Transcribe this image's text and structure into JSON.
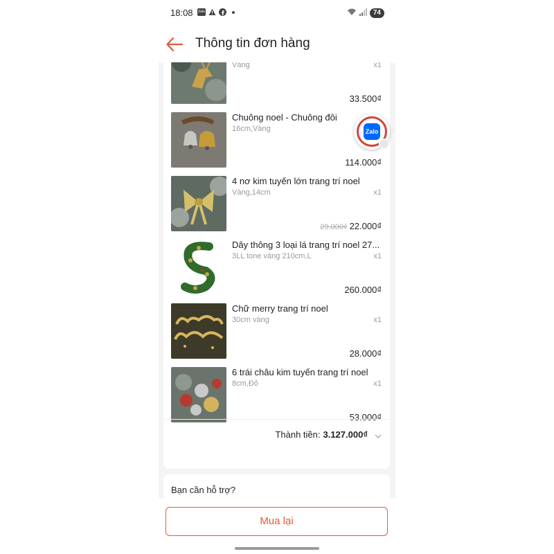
{
  "status_bar": {
    "time": "18:08",
    "battery": "74",
    "left_icons": [
      "zalo-icon",
      "warning-icon",
      "facebook-icon",
      "dot-icon"
    ],
    "right_icons": [
      "wifi-icon",
      "signal-icon"
    ]
  },
  "header": {
    "title": "Thông tin đơn hàng",
    "accent_color": "#e05a3a"
  },
  "products": [
    {
      "name": "",
      "variant": "Vàng",
      "qty": "x1",
      "price": "33.500₫",
      "old_price": "",
      "thumb": "reindeer-ornament"
    },
    {
      "name": "Chuông noel - Chuông đôi",
      "variant": "16cm,Vàng",
      "qty": "",
      "price": "114.000₫",
      "old_price": "",
      "thumb": "double-bell"
    },
    {
      "name": "4 nơ kim tuyến lớn trang trí noel",
      "variant": "Vàng,14cm",
      "qty": "x1",
      "price": "22.000₫",
      "old_price": "29.000₫",
      "thumb": "glitter-bow"
    },
    {
      "name": "Dây thông 3 loại lá trang trí noel 27...",
      "variant": "3LL tone vàng 210cm,L",
      "qty": "x1",
      "price": "260.000₫",
      "old_price": "",
      "thumb": "garland"
    },
    {
      "name": "Chữ merry trang trí noel",
      "variant": "30cm vàng",
      "qty": "x1",
      "price": "28.000₫",
      "old_price": "",
      "thumb": "merry-christmas-sign"
    },
    {
      "name": "6 trái châu kim tuyến trang trí noel",
      "variant": "8cm,Đỏ",
      "qty": "x1",
      "price": "53.000₫",
      "old_price": "",
      "thumb": "glitter-balls"
    }
  ],
  "total": {
    "label": "Thành tiền:",
    "value": "3.127.000₫"
  },
  "support": {
    "title": "Bạn cần hỗ trợ?"
  },
  "zalo": {
    "label": "Zalo"
  },
  "bottom": {
    "rebuy_label": "Mua lại"
  }
}
